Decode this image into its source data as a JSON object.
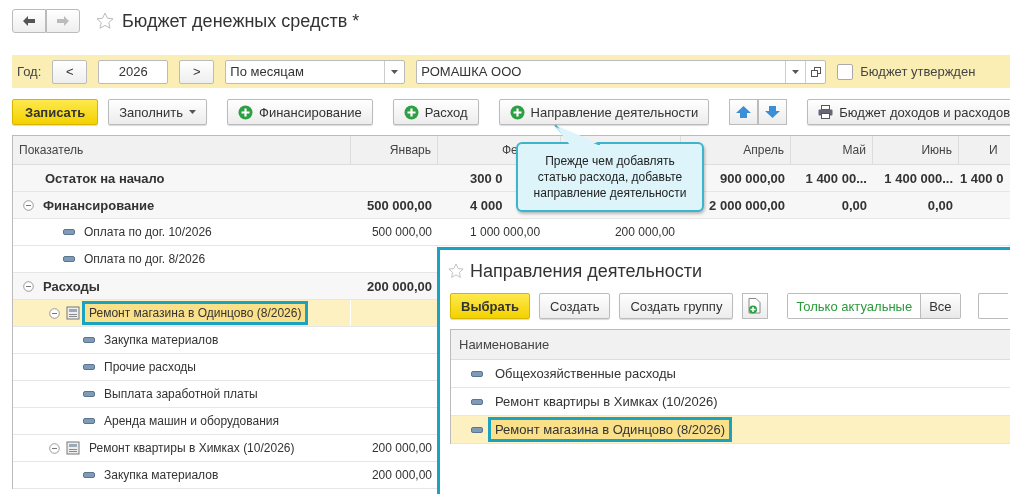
{
  "window": {
    "title": "Бюджет денежных средств *"
  },
  "filter": {
    "year_label": "Год:",
    "prev": "<",
    "year": "2026",
    "next": ">",
    "period": "По месяцам",
    "organization": "РОМАШКА ООО",
    "approved": {
      "label": "Бюджет утвержден",
      "checked": false
    }
  },
  "toolbar": [
    {
      "kind": "primary",
      "label": "Записать"
    },
    {
      "kind": "dropdown",
      "label": "Заполнить"
    },
    {
      "kind": "add",
      "label": "Финансирование"
    },
    {
      "kind": "add",
      "label": "Расход"
    },
    {
      "kind": "add",
      "label": "Направление деятельности"
    },
    {
      "kind": "move"
    },
    {
      "kind": "print",
      "label": "Бюджет доходов и расходов"
    }
  ],
  "callout": {
    "text": "Прежде чем добавлять статью расхода, добавьте направление деятельности"
  },
  "table": {
    "columns": {
      "col_0": "Показатель",
      "col_1": "Январь",
      "col_2": "Фе",
      "col_4": "Апрель",
      "col_5": "Май",
      "col_6": "Июнь",
      "col_7": "И"
    },
    "rows": [
      {
        "kind": "total",
        "label": "Остаток на начало",
        "selected": false,
        "values": {
          "col_2": "300 0",
          "col_4": "900 000,00",
          "col_5": "1 400 00...",
          "col_6": "1 400 000...",
          "col_7": "1 400 0"
        }
      },
      {
        "kind": "section",
        "label": "Финансирование",
        "expanded": true,
        "selected": false,
        "values": {
          "col_1": "500 000,00",
          "col_2": "4 000",
          "col_4": "2 000 000,00",
          "col_5": "0,00",
          "col_6": "0,00"
        },
        "children": [
          {
            "kind": "item",
            "label": "Оплата по дог. 10/2026",
            "selected": false,
            "values": {
              "col_1": "500 000,00",
              "col_2": "1 000 000,00",
              "col_3": "200 000,00"
            }
          },
          {
            "kind": "item",
            "label": "Оплата по дог. 8/2026",
            "selected": false
          }
        ]
      },
      {
        "kind": "section",
        "label": "Расходы",
        "expanded": true,
        "selected": false,
        "values": {
          "col_1": "200 000,00"
        },
        "children": [
          {
            "kind": "project",
            "label": "Ремонт магазина в Одинцово (8/2026)",
            "expanded": true,
            "selected": true,
            "children": [
              {
                "kind": "item",
                "label": "Закупка материалов",
                "selected": false
              },
              {
                "kind": "item",
                "label": "Прочие расходы",
                "selected": false
              },
              {
                "kind": "item",
                "label": "Выплата заработной платы",
                "selected": false
              },
              {
                "kind": "item",
                "label": "Аренда машин и оборудования",
                "selected": false
              }
            ]
          },
          {
            "kind": "project",
            "label": "Ремонт квартиры в Химках (10/2026)",
            "expanded": true,
            "selected": false,
            "values": {
              "col_1": "200 000,00"
            },
            "children": [
              {
                "kind": "item",
                "label": "Закупка материалов",
                "selected": false,
                "values": {
                  "col_1": "200 000,00"
                }
              }
            ]
          }
        ]
      }
    ]
  },
  "popup": {
    "title": "Направления деятельности",
    "buttons": [
      {
        "kind": "primary",
        "label": "Выбрать"
      },
      {
        "kind": "plain",
        "label": "Создать"
      },
      {
        "kind": "plain",
        "label": "Создать группу"
      },
      {
        "kind": "copy"
      }
    ],
    "filter_options": [
      {
        "label": "Только актуальные",
        "selected": true
      },
      {
        "label": "Все",
        "selected": false
      }
    ],
    "column": "Наименование",
    "rows": [
      {
        "label": "Общехозяйственные расходы",
        "selected": false
      },
      {
        "label": "Ремонт квартиры в Химках (10/2026)",
        "selected": false
      },
      {
        "label": "Ремонт магазина в Одинцово (8/2026)",
        "selected": true
      }
    ]
  }
}
